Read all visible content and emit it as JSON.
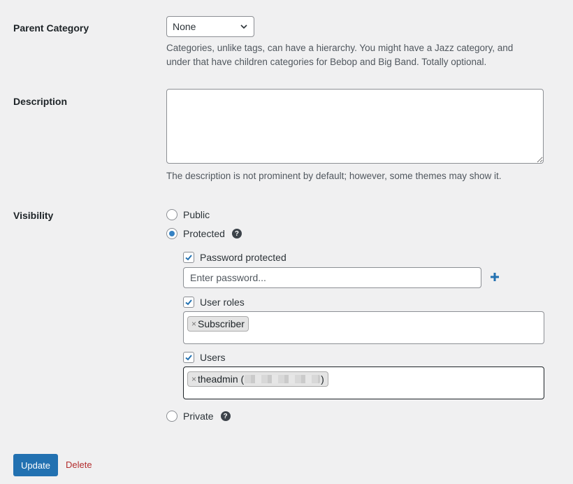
{
  "parent_category": {
    "label": "Parent Category",
    "selected": "None",
    "help": "Categories, unlike tags, can have a hierarchy. You might have a Jazz category, and under that have children categories for Bebop and Big Band. Totally optional."
  },
  "description": {
    "label": "Description",
    "value": "",
    "help": "The description is not prominent by default; however, some themes may show it."
  },
  "visibility": {
    "label": "Visibility",
    "options": {
      "public": "Public",
      "protected": "Protected",
      "private": "Private"
    },
    "selected": "protected",
    "password_protected": {
      "label": "Password protected",
      "checked": true,
      "placeholder": "Enter password..."
    },
    "user_roles": {
      "label": "User roles",
      "checked": true,
      "tags": [
        "Subscriber"
      ]
    },
    "users": {
      "label": "Users",
      "checked": true,
      "tag_prefix": "theadmin (",
      "tag_suffix": ")"
    }
  },
  "actions": {
    "update": "Update",
    "delete": "Delete"
  },
  "colors": {
    "primary": "#2271b1",
    "delete": "#b32d2e",
    "radio_checked": "#3582c4"
  }
}
